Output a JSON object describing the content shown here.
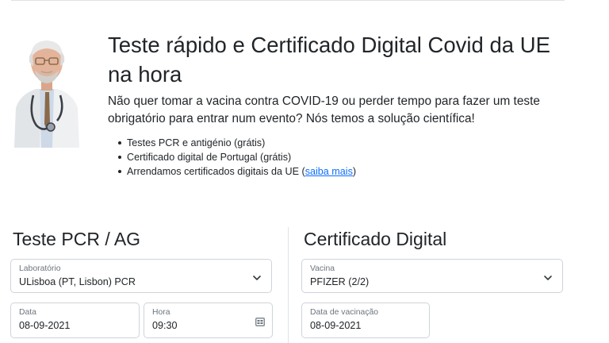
{
  "hero": {
    "title": "Teste rápido e Certificado Digital Covid da UE na hora",
    "lead": "Não quer tomar a vacina contra COVID-19 ou perder tempo para fazer um teste obrigatório para entrar num evento? Nós temos a solução científica!",
    "features": [
      "Testes PCR e antigénio (grátis)",
      "Certificado digital de Portugal (grátis)"
    ],
    "feature3_prefix": "Arrendamos certificados digitais da UE (",
    "feature3_link": "saiba mais",
    "feature3_suffix": ")"
  },
  "test_section": {
    "title": "Teste PCR / AG",
    "lab": {
      "label": "Laboratório",
      "value": "ULisboa (PT, Lisbon) PCR"
    },
    "date": {
      "label": "Data",
      "value": "08-09-2021"
    },
    "time": {
      "label": "Hora",
      "value": "09:30"
    }
  },
  "certificate_section": {
    "title": "Certificado Digital",
    "vaccine": {
      "label": "Vacina",
      "value": "PFIZER (2/2)"
    },
    "vaccination_date": {
      "label": "Data de vacinação",
      "value": "08-09-2021"
    }
  },
  "icons": {
    "select_chevron": "chevron-down-icon",
    "time_picker": "calendar-icon"
  }
}
